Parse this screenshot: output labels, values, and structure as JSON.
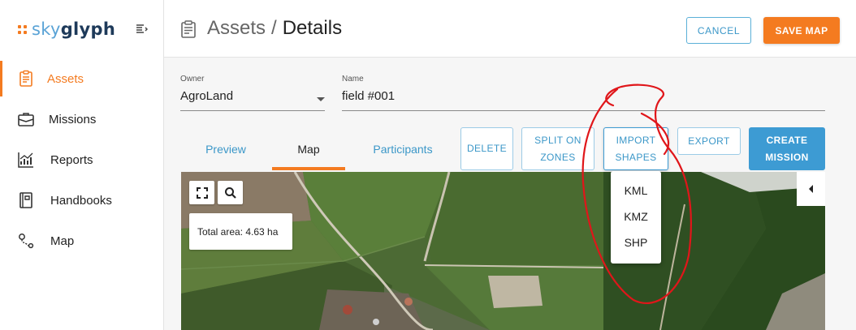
{
  "app": {
    "logo_sky": "sky",
    "logo_glyph": "glyph",
    "brand_color": "#f47b20",
    "accent_color": "#3d9bd3"
  },
  "sidebar": {
    "collapse_icon": "menu-collapse-icon",
    "items": [
      {
        "label": "Assets",
        "icon": "clipboard-icon",
        "active": true
      },
      {
        "label": "Missions",
        "icon": "briefcase-icon",
        "active": false
      },
      {
        "label": "Reports",
        "icon": "chart-icon",
        "active": false
      },
      {
        "label": "Handbooks",
        "icon": "book-icon",
        "active": false
      },
      {
        "label": "Map",
        "icon": "route-icon",
        "active": false
      }
    ]
  },
  "header": {
    "breadcrumb_parent": "Assets",
    "breadcrumb_separator": "/",
    "breadcrumb_current": "Details",
    "cancel_label": "CANCEL",
    "save_label": "SAVE MAP"
  },
  "form": {
    "owner_label": "Owner",
    "owner_value": "AgroLand",
    "name_label": "Name",
    "name_value": "field #001"
  },
  "tabs": [
    {
      "label": "Preview",
      "active": false
    },
    {
      "label": "Map",
      "active": true
    },
    {
      "label": "Participants",
      "active": false
    }
  ],
  "actions": {
    "delete_label": "DELETE",
    "split_label_1": "SPLIT ON",
    "split_label_2": "ZONES",
    "import_label_1": "IMPORT",
    "import_label_2": "SHAPES",
    "export_label": "EXPORT",
    "create_label_1": "CREATE",
    "create_label_2": "MISSION"
  },
  "map": {
    "total_area_text": "Total area: 4.63 ha",
    "fullscreen_icon": "fullscreen-icon",
    "search_icon": "search-icon",
    "toggle_icon": "chevron-left-icon"
  },
  "import_menu": {
    "options": [
      "KML",
      "KMZ",
      "SHP"
    ]
  },
  "annotation_color": "#e0161a"
}
